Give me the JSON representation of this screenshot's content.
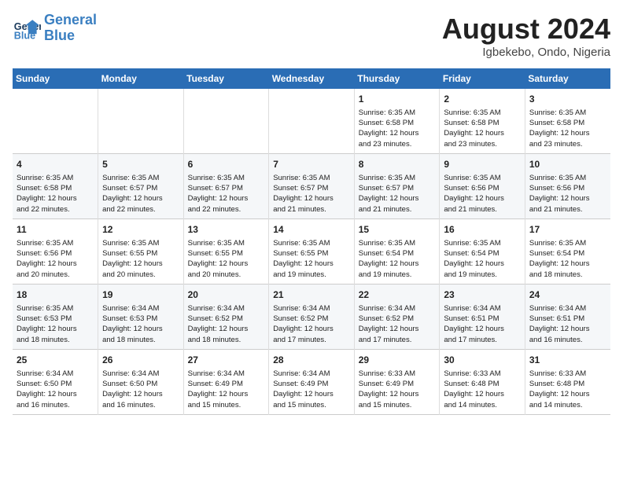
{
  "header": {
    "logo_line1": "General",
    "logo_line2": "Blue",
    "month_title": "August 2024",
    "location": "Igbekebo, Ondo, Nigeria"
  },
  "weekdays": [
    "Sunday",
    "Monday",
    "Tuesday",
    "Wednesday",
    "Thursday",
    "Friday",
    "Saturday"
  ],
  "weeks": [
    [
      {
        "day": "",
        "detail": ""
      },
      {
        "day": "",
        "detail": ""
      },
      {
        "day": "",
        "detail": ""
      },
      {
        "day": "",
        "detail": ""
      },
      {
        "day": "1",
        "detail": "Sunrise: 6:35 AM\nSunset: 6:58 PM\nDaylight: 12 hours\nand 23 minutes."
      },
      {
        "day": "2",
        "detail": "Sunrise: 6:35 AM\nSunset: 6:58 PM\nDaylight: 12 hours\nand 23 minutes."
      },
      {
        "day": "3",
        "detail": "Sunrise: 6:35 AM\nSunset: 6:58 PM\nDaylight: 12 hours\nand 23 minutes."
      }
    ],
    [
      {
        "day": "4",
        "detail": "Sunrise: 6:35 AM\nSunset: 6:58 PM\nDaylight: 12 hours\nand 22 minutes."
      },
      {
        "day": "5",
        "detail": "Sunrise: 6:35 AM\nSunset: 6:57 PM\nDaylight: 12 hours\nand 22 minutes."
      },
      {
        "day": "6",
        "detail": "Sunrise: 6:35 AM\nSunset: 6:57 PM\nDaylight: 12 hours\nand 22 minutes."
      },
      {
        "day": "7",
        "detail": "Sunrise: 6:35 AM\nSunset: 6:57 PM\nDaylight: 12 hours\nand 21 minutes."
      },
      {
        "day": "8",
        "detail": "Sunrise: 6:35 AM\nSunset: 6:57 PM\nDaylight: 12 hours\nand 21 minutes."
      },
      {
        "day": "9",
        "detail": "Sunrise: 6:35 AM\nSunset: 6:56 PM\nDaylight: 12 hours\nand 21 minutes."
      },
      {
        "day": "10",
        "detail": "Sunrise: 6:35 AM\nSunset: 6:56 PM\nDaylight: 12 hours\nand 21 minutes."
      }
    ],
    [
      {
        "day": "11",
        "detail": "Sunrise: 6:35 AM\nSunset: 6:56 PM\nDaylight: 12 hours\nand 20 minutes."
      },
      {
        "day": "12",
        "detail": "Sunrise: 6:35 AM\nSunset: 6:55 PM\nDaylight: 12 hours\nand 20 minutes."
      },
      {
        "day": "13",
        "detail": "Sunrise: 6:35 AM\nSunset: 6:55 PM\nDaylight: 12 hours\nand 20 minutes."
      },
      {
        "day": "14",
        "detail": "Sunrise: 6:35 AM\nSunset: 6:55 PM\nDaylight: 12 hours\nand 19 minutes."
      },
      {
        "day": "15",
        "detail": "Sunrise: 6:35 AM\nSunset: 6:54 PM\nDaylight: 12 hours\nand 19 minutes."
      },
      {
        "day": "16",
        "detail": "Sunrise: 6:35 AM\nSunset: 6:54 PM\nDaylight: 12 hours\nand 19 minutes."
      },
      {
        "day": "17",
        "detail": "Sunrise: 6:35 AM\nSunset: 6:54 PM\nDaylight: 12 hours\nand 18 minutes."
      }
    ],
    [
      {
        "day": "18",
        "detail": "Sunrise: 6:35 AM\nSunset: 6:53 PM\nDaylight: 12 hours\nand 18 minutes."
      },
      {
        "day": "19",
        "detail": "Sunrise: 6:34 AM\nSunset: 6:53 PM\nDaylight: 12 hours\nand 18 minutes."
      },
      {
        "day": "20",
        "detail": "Sunrise: 6:34 AM\nSunset: 6:52 PM\nDaylight: 12 hours\nand 18 minutes."
      },
      {
        "day": "21",
        "detail": "Sunrise: 6:34 AM\nSunset: 6:52 PM\nDaylight: 12 hours\nand 17 minutes."
      },
      {
        "day": "22",
        "detail": "Sunrise: 6:34 AM\nSunset: 6:52 PM\nDaylight: 12 hours\nand 17 minutes."
      },
      {
        "day": "23",
        "detail": "Sunrise: 6:34 AM\nSunset: 6:51 PM\nDaylight: 12 hours\nand 17 minutes."
      },
      {
        "day": "24",
        "detail": "Sunrise: 6:34 AM\nSunset: 6:51 PM\nDaylight: 12 hours\nand 16 minutes."
      }
    ],
    [
      {
        "day": "25",
        "detail": "Sunrise: 6:34 AM\nSunset: 6:50 PM\nDaylight: 12 hours\nand 16 minutes."
      },
      {
        "day": "26",
        "detail": "Sunrise: 6:34 AM\nSunset: 6:50 PM\nDaylight: 12 hours\nand 16 minutes."
      },
      {
        "day": "27",
        "detail": "Sunrise: 6:34 AM\nSunset: 6:49 PM\nDaylight: 12 hours\nand 15 minutes."
      },
      {
        "day": "28",
        "detail": "Sunrise: 6:34 AM\nSunset: 6:49 PM\nDaylight: 12 hours\nand 15 minutes."
      },
      {
        "day": "29",
        "detail": "Sunrise: 6:33 AM\nSunset: 6:49 PM\nDaylight: 12 hours\nand 15 minutes."
      },
      {
        "day": "30",
        "detail": "Sunrise: 6:33 AM\nSunset: 6:48 PM\nDaylight: 12 hours\nand 14 minutes."
      },
      {
        "day": "31",
        "detail": "Sunrise: 6:33 AM\nSunset: 6:48 PM\nDaylight: 12 hours\nand 14 minutes."
      }
    ]
  ]
}
